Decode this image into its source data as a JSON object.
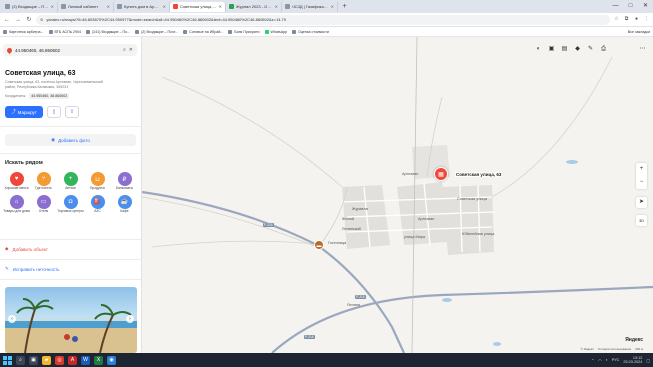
{
  "browser": {
    "tabs": [
      {
        "label": "(2) Входящие – Почта Mail",
        "active": false
      },
      {
        "label": "Личный кабинет",
        "active": false
      },
      {
        "label": "Купить дом в Армавире",
        "active": false
      },
      {
        "label": "Советская улица, 63 — Яндекс",
        "active": true
      },
      {
        "label": "Журнал 2023 - Google Табл.",
        "active": false
      },
      {
        "label": "ЧСЗД | Газификационный",
        "active": false
      }
    ],
    "new_tab": "+",
    "window_controls": {
      "minimize": "—",
      "maximize": "□",
      "close": "✕"
    },
    "url": "yandex.ru/maps/?ll=46.603870%2C44.950977&mode=search&sll=44.950460%2C46.860602&text=44.950460%2C46.860602&z=14.79",
    "bookmarks": [
      "Картотека арбитра...",
      "ВТБ АСПЬ 2904",
      "(241) Входящие – По...",
      "(2) Входящие – Почт...",
      "Сотовые на Ибрай...",
      "Банк Приорити",
      "WhatsApp",
      "Оценка стоимости"
    ],
    "bookmarks_other": "Все закладки"
  },
  "panel": {
    "search_value": "44.950460, 46.860602",
    "place_title": "Советская улица, 63",
    "place_address": "Советская улица, 63, посёлок Артезиан, Черноземельский район, Республика Калмыкия, 359231",
    "coords_label": "Координаты:",
    "coords_value": "44.950460, 46.860602",
    "route_label": "Маршрут",
    "add_photo": "Добавить фото",
    "nearby_title": "Искать рядом",
    "categories": [
      {
        "label": "Хорошие места",
        "icon": "heart-icon",
        "color": "#f0473b"
      },
      {
        "label": "Где поесть",
        "icon": "fork-icon",
        "color": "#f39a33"
      },
      {
        "label": "Аптеки",
        "icon": "cross-icon",
        "color": "#33b55d"
      },
      {
        "label": "Продукты",
        "icon": "basket-icon",
        "color": "#f39a33"
      },
      {
        "label": "Банкоматы",
        "icon": "ruble-icon",
        "color": "#8a6fd1"
      },
      {
        "label": "Товары для дома",
        "icon": "home-icon",
        "color": "#8a6fd1"
      },
      {
        "label": "Отели",
        "icon": "bed-icon",
        "color": "#8a6fd1"
      },
      {
        "label": "Торговые центры",
        "icon": "bag-icon",
        "color": "#4a8ef0"
      },
      {
        "label": "АЗС",
        "icon": "fuel-icon",
        "color": "#4a8ef0"
      },
      {
        "label": "Кафе",
        "icon": "cup-icon",
        "color": "#4a8ef0"
      }
    ],
    "add_object": "Добавить объект",
    "fix_error": "Исправить неточность"
  },
  "map": {
    "target_label": "Советская улица, 63",
    "labels": [
      {
        "text": "Артезиан"
      },
      {
        "text": "Артезиан"
      },
      {
        "text": "Журавли"
      },
      {
        "text": "Жилой"
      },
      {
        "text": "Ленинский"
      },
      {
        "text": "Гостиница"
      },
      {
        "text": "Ленина"
      },
      {
        "text": "Юбилейная улица"
      },
      {
        "text": "Советская улица"
      },
      {
        "text": "улица Мира"
      }
    ],
    "road_badges": [
      "Р-216",
      "Р-216",
      "Р-216"
    ],
    "logo": "Яндекс",
    "footer": [
      "© Яндекс",
      "Условия использования",
      "200 м"
    ],
    "colors": {
      "background": "#f4f3ef",
      "road": "#9aa7bf",
      "block": "#e2e0dc",
      "water": "#a8cbe8"
    }
  },
  "taskbar": {
    "lang": "РУС",
    "time": "13:12",
    "date": "25.03.2024"
  }
}
